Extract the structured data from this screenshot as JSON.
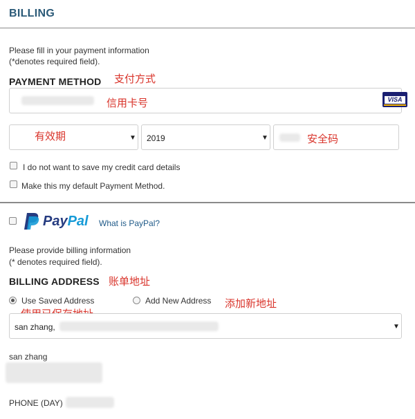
{
  "header": {
    "title": "BILLING"
  },
  "payment": {
    "intro_line1": "Please fill in your payment information",
    "intro_line2": "(*denotes required field).",
    "section_title": "PAYMENT METHOD",
    "annotation_method": "支付方式",
    "annotation_card": "信用卡号",
    "card_logo_text": "VISA",
    "annotation_expiry": "有效期",
    "year_value": "2019",
    "annotation_cvv": "安全码",
    "checkbox_no_save": "I do not want to save my credit card details",
    "checkbox_default": "Make this my default Payment Method."
  },
  "paypal": {
    "brand_pay": "Pay",
    "brand_pal": "Pal",
    "what_is_link": "What is PayPal?"
  },
  "billing": {
    "intro_line1": "Please provide billing information",
    "intro_line2": "(* denotes required field).",
    "section_title": "BILLING ADDRESS",
    "annotation_address": "账单地址",
    "radio_saved": "Use Saved Address",
    "radio_new": "Add New Address",
    "annotation_new": "添加新地址",
    "annotation_saved": "使用已保存地址",
    "saved_address_value": "san zhang,",
    "name": "san zhang",
    "phone_label": "PHONE (DAY)"
  },
  "colors": {
    "title": "#2b5a78",
    "annotation": "#d9342b",
    "paypal_dark": "#253b80",
    "paypal_light": "#179bd7",
    "visa": "#1a1f71"
  }
}
